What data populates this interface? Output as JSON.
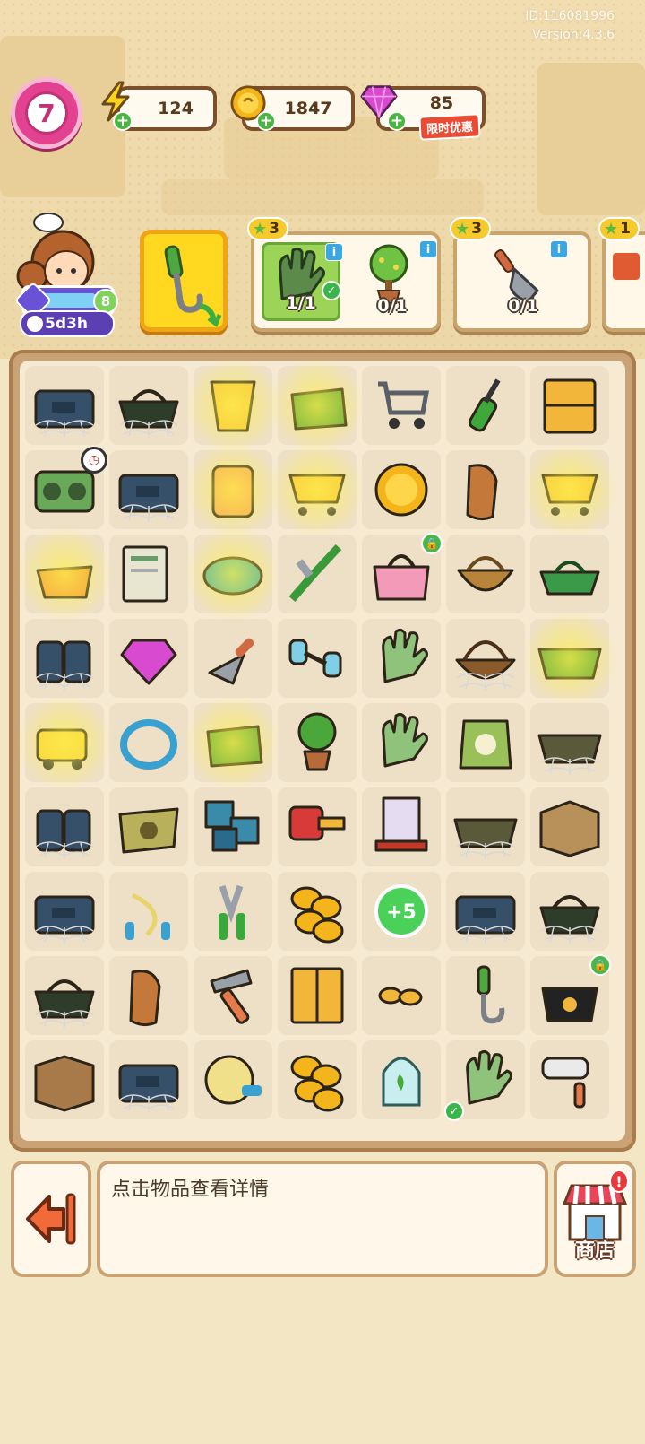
{
  "meta": {
    "id_text": "ID:116081996",
    "version_text": "Version:4.3.6"
  },
  "topbar": {
    "level": "7",
    "energy": "124",
    "coins": "1847",
    "gems": "85",
    "promo_label": "限时优惠"
  },
  "player": {
    "event_timer": "5d3h",
    "badge_level": "8"
  },
  "orders": [
    {
      "stars": "3",
      "items": [
        {
          "icon": "glove-icon",
          "count": "1/1",
          "done": true
        },
        {
          "icon": "tree-icon",
          "count": "0/1",
          "done": false
        }
      ]
    },
    {
      "stars": "3",
      "items": [
        {
          "icon": "shovel-icon",
          "count": "0/1",
          "done": false
        }
      ]
    },
    {
      "stars": "1",
      "items": []
    }
  ],
  "board": {
    "items": [
      [
        "toolbox-web",
        "basket-web",
        "bucket-energy",
        "bag-energy",
        "cart",
        "screwdriver",
        "drawer"
      ],
      [
        "radio",
        "toolbox-web",
        "bottle-energy",
        "cart-energy",
        "coin",
        "bread",
        "cart-energy"
      ],
      [
        "basket-energy",
        "newspaper",
        "cushion-energy",
        "pliers",
        "pink-bag",
        "wicker-basket",
        "green-basket"
      ],
      [
        "box-web",
        "gem",
        "trowel",
        "dumbbell",
        "gloves",
        "wicker-web",
        "tray-energy"
      ],
      [
        "mower-energy",
        "ring",
        "bag-energy",
        "potted-tree",
        "gloves",
        "seed-bag",
        "tray-web"
      ],
      [
        "box-web",
        "seed-sack",
        "tiles",
        "key",
        "boxes-dolly",
        "tray-web",
        "cardboard-box"
      ],
      [
        "toolbox-web",
        "jump-rope",
        "cutter",
        "coins-stack",
        "plus5-token",
        "toolbox-web",
        "basket-web"
      ],
      [
        "basket-web",
        "bread",
        "hammer",
        "cabinet",
        "bread-small",
        "hook",
        "black-bag"
      ],
      [
        "crate",
        "toolbox-web",
        "yarn",
        "coins-stack",
        "terrarium",
        "gloves",
        "roller"
      ]
    ]
  },
  "bottom": {
    "hint": "点击物品查看详情",
    "shop_label": "商店",
    "shop_alert": "!"
  },
  "colors": {
    "accent": "#ffd81f",
    "board_frame": "#c9a275",
    "background": "#f3e6c4"
  }
}
